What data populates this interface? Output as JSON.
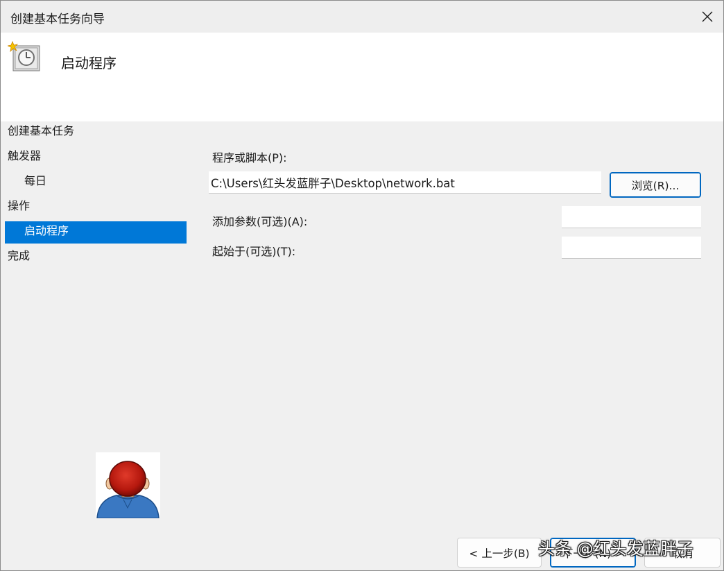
{
  "window": {
    "title": "创建基本任务向导"
  },
  "header": {
    "title": "启动程序"
  },
  "nav": {
    "items": [
      {
        "label": "创建基本任务"
      },
      {
        "label": "触发器"
      },
      {
        "label": "每日"
      },
      {
        "label": "操作"
      },
      {
        "label": "启动程序"
      },
      {
        "label": "完成"
      }
    ],
    "selected": "启动程序"
  },
  "form": {
    "program_label": "程序或脚本(P):",
    "program_value": "C:\\Users\\红头发蓝胖子\\Desktop\\network.bat",
    "browse_label": "浏览(R)...",
    "args_label": "添加参数(可选)(A):",
    "args_value": "",
    "startin_label": "起始于(可选)(T):",
    "startin_value": ""
  },
  "footer": {
    "back_label": "< 上一步(B)",
    "next_label": "下一步(N) >",
    "cancel_label": "取消"
  },
  "watermark": "头条 @红头发蓝胖子",
  "colors": {
    "accent": "#0078d7",
    "background": "#f0f0f0",
    "header_background": "#ffffff"
  },
  "icons": {
    "close": "close-icon",
    "header": "scheduled-task-clock-icon",
    "avatar": "red-haired-avatar-icon"
  }
}
